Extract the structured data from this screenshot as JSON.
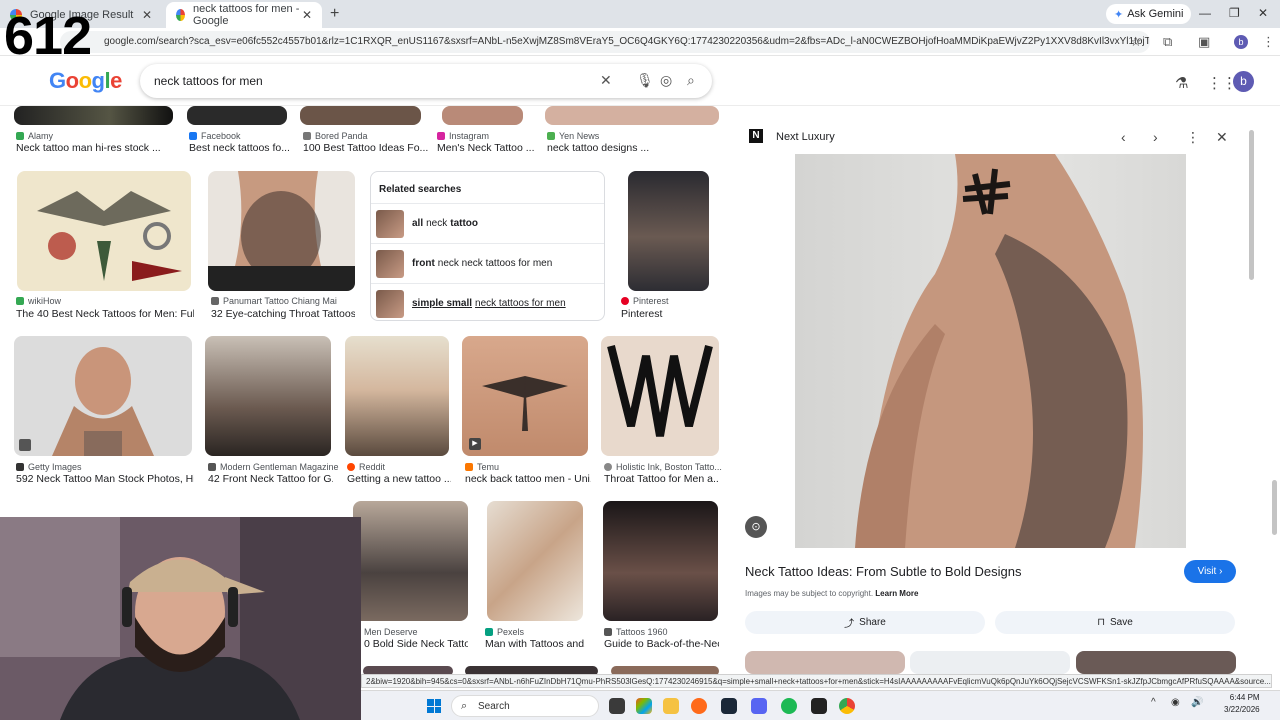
{
  "overlay_number": "612",
  "browser": {
    "tabs": [
      {
        "label": "Google Image Result",
        "active": false
      },
      {
        "label": "neck tattoos for men - Google",
        "active": true
      }
    ],
    "ask_gemini": "Ask Gemini",
    "url": "google.com/search?sca_esv=e06fc552c4557b01&rlz=1C1RXQR_enUS1167&sxsrf=ANbL-n5eXwjMZ8Sm8VEraY5_OC6Q4GKY6Q:1774230220356&udm=2&fbs=ADc_l-aN0CWEZBOHjofHoaMMDiKpaEWjvZ2Py1XXV8d8KvIl3vxYl1tojT_24H7Q4iMwcl...",
    "profile_initial": "b"
  },
  "google": {
    "query": "neck tattoos for men",
    "avatar_initial": "b"
  },
  "row0": [
    {
      "source": "Alamy",
      "title": "Neck tattoo man hi-res stock ...",
      "color": "#34a853"
    },
    {
      "source": "Facebook",
      "title": "Best neck tattoos fo...",
      "color": "#1877f2"
    },
    {
      "source": "Bored Panda",
      "title": "100 Best Tattoo Ideas Fo...",
      "color": "#777777"
    },
    {
      "source": "Instagram",
      "title": "Men's Neck Tattoo ...",
      "color": "#d6249f"
    },
    {
      "source": "Yen News",
      "title": "neck tattoo designs ...",
      "color": "#4caf50"
    }
  ],
  "row1": [
    {
      "source": "wikiHow",
      "title": "The 40 Best Neck Tattoos for Men: Full ...",
      "color": "#34a853"
    },
    {
      "source": "Panumart Tattoo Chiang Mai",
      "title": "32 Eye-catching Throat Tattoos ...",
      "color": "#666666"
    },
    {
      "source": "Pinterest",
      "title": "Pinterest",
      "color": "#e60023"
    }
  ],
  "related": {
    "heading": "Related searches",
    "items": [
      {
        "bold": "all",
        "rest": "neck",
        "bold2": "tattoo"
      },
      {
        "bold": "front",
        "rest": "neck neck tattoos for men",
        "bold2": ""
      },
      {
        "bold": "simple small",
        "rest": "neck tattoos for men",
        "bold2": ""
      }
    ]
  },
  "row2": [
    {
      "source": "Getty Images",
      "title": "592 Neck Tattoo Man Stock Photos, Hi...",
      "color": "#333333"
    },
    {
      "source": "Modern Gentleman Magazine",
      "title": "42 Front Neck Tattoo for G...",
      "color": "#555555"
    },
    {
      "source": "Reddit",
      "title": "Getting a new tattoo ...",
      "color": "#ff4500"
    },
    {
      "source": "Temu",
      "title": "neck back tattoo men - Uni...",
      "color": "#fb7701"
    },
    {
      "source": "Holistic Ink, Boston Tatto...",
      "title": "Throat Tattoo for Men a...",
      "color": "#888888"
    }
  ],
  "row3": [
    {
      "source": "Men Deserve",
      "title": "0 Bold Side Neck Tatto...",
      "color": "#333333"
    },
    {
      "source": "Pexels",
      "title": "Man with Tattoos and...",
      "color": "#05a081"
    },
    {
      "source": "Tattoos 1960",
      "title": "Guide to Back-of-the-Nec...",
      "color": "#555555"
    }
  ],
  "panel": {
    "site": "Next Luxury",
    "site_logo": "N",
    "title": "Neck Tattoo Ideas: From Subtle to Bold Designs",
    "visit_label": "Visit",
    "copyright": "Images may be subject to copyright.",
    "learn_more": "Learn More",
    "share_label": "Share",
    "save_label": "Save"
  },
  "status_url": "2&biw=1920&bih=945&cs=0&sxsrf=ANbL-n6hFuZInDbH71Qmu-PhRS503lGesQ:1774230246915&q=simple+small+neck+tattoos+for+men&stick=H4sIAAAAAAAAAFvEqlicmVuQk6pQnJuYk6OQjSejcVCSWFKSn1-skJZfpJCbmgcAfPRfuSQAAAA&source...",
  "taskbar": {
    "search_label": "Search",
    "time": "6:44 PM",
    "date": "3/22/2026"
  }
}
